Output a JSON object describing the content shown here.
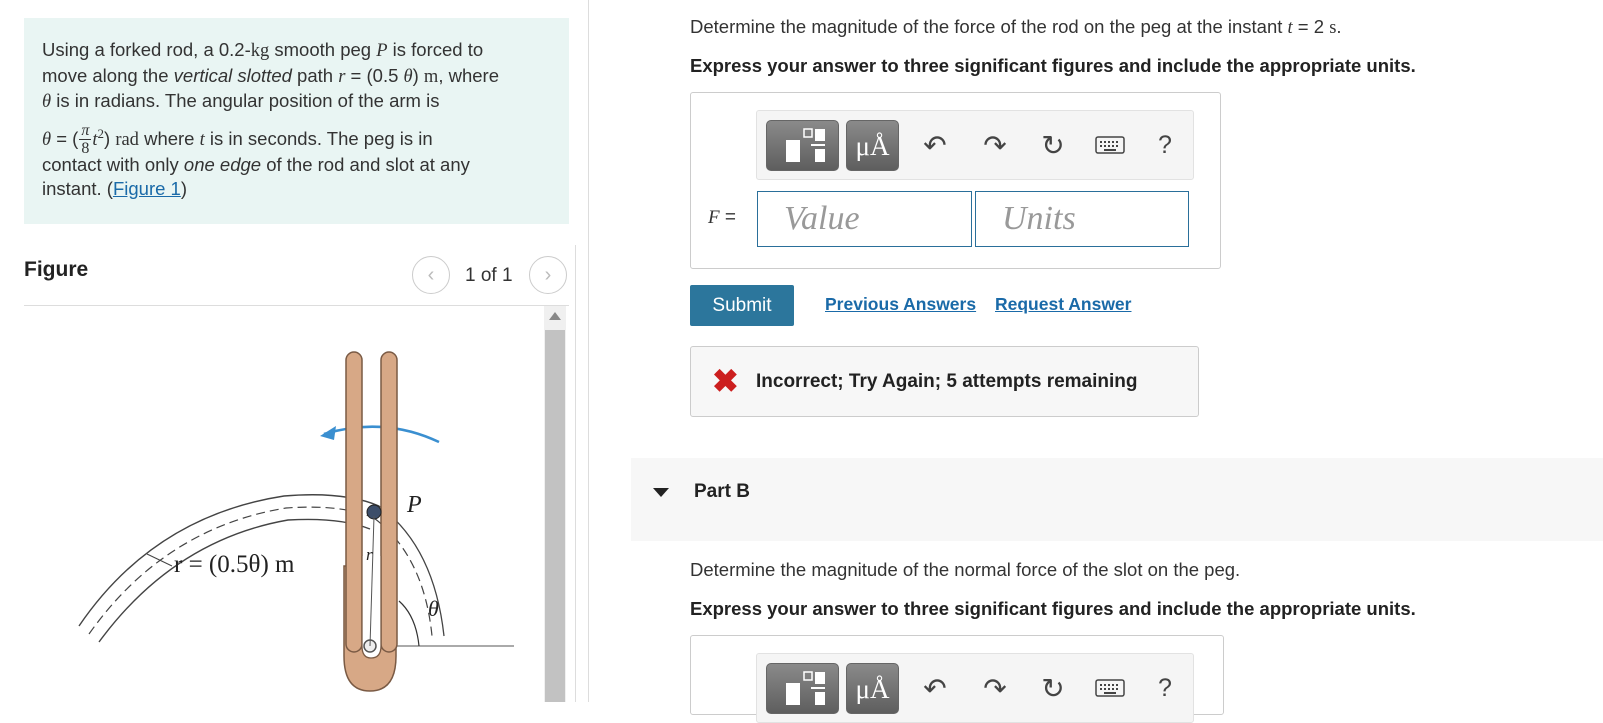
{
  "problem": {
    "l1_a": "Using a forked rod, a 0.2-",
    "l1_kg": "kg",
    "l1_b": " smooth peg ",
    "l1_P": "P",
    "l1_c": " is forced to",
    "l2_a": "move along the ",
    "l2_em": "vertical slotted",
    "l2_b": " path ",
    "l2_r": "r",
    "l2_c": " = (0.5 ",
    "l2_theta": "θ",
    "l2_d": ") ",
    "l2_m": "m",
    "l2_e": ", where",
    "l3_theta": "θ",
    "l3_a": " is in radians. The angular position of the arm is",
    "l4_theta": "θ",
    "l4_a": " = (",
    "l4_num": "π",
    "l4_den": "8",
    "l4_t": "t",
    "l4_sup": "2",
    "l4_b": ") ",
    "l4_rad": "rad",
    "l4_c": " where ",
    "l4_t2": "t",
    "l4_d": " is in seconds. The peg is in",
    "l5_a": "contact with only ",
    "l5_em": "one edge",
    "l5_b": " of the rod and slot at any",
    "l6_a": "instant. (",
    "l6_link": "Figure 1",
    "l6_b": ")"
  },
  "figure": {
    "title": "Figure",
    "pager_count": "1 of 1",
    "label_P": "P",
    "label_r": "r",
    "label_theta": "θ",
    "label_path": "r = (0.5θ) m"
  },
  "partA": {
    "question_a": "Determine the magnitude of the force of the rod on the peg at the instant ",
    "question_t": "t",
    "question_b": " = 2 ",
    "question_s": "s",
    "question_c": ".",
    "instruction": "Express your answer to three significant figures and include the appropriate units.",
    "var_label_F": "F",
    "var_label_eq": " =",
    "value_placeholder": "Value",
    "units_placeholder": "Units",
    "mu_label": "μÅ",
    "help": "?",
    "submit": "Submit",
    "previous_answers": "Previous Answers",
    "request_answer": "Request Answer",
    "feedback": "Incorrect; Try Again; 5 attempts remaining",
    "feedback_icon": "✖"
  },
  "partB": {
    "label": "Part B",
    "question": "Determine the magnitude of the normal force of the slot on the peg.",
    "instruction": "Express your answer to three significant figures and include the appropriate units.",
    "mu_label": "μÅ",
    "help": "?"
  },
  "colors": {
    "problem_bg": "#e9f5f3",
    "accent": "#2c769c",
    "link": "#1a6aa8",
    "error": "#cc1f1f"
  }
}
